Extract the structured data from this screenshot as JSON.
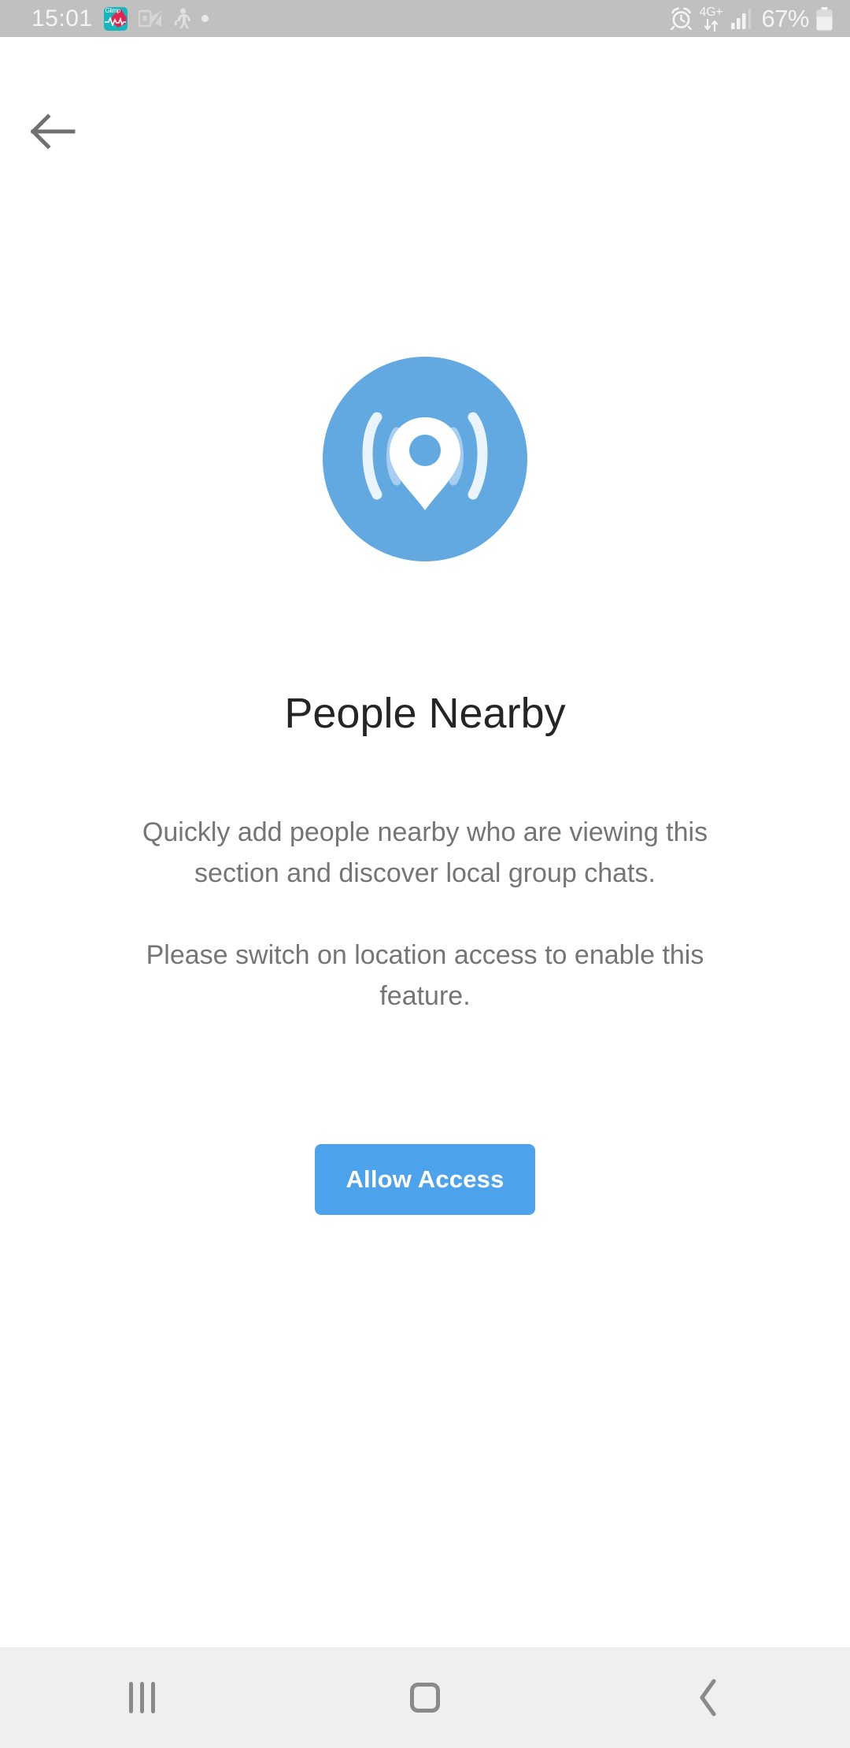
{
  "status_bar": {
    "clock": "15:01",
    "left_icons": [
      {
        "name": "glimp-app-icon",
        "label": "Glimp"
      },
      {
        "name": "outlook-notification-icon",
        "label": ""
      },
      {
        "name": "walking-person-icon",
        "label": ""
      },
      {
        "name": "notification-dot-icon",
        "label": ""
      }
    ],
    "network_type": "4G+",
    "battery_percent": "67%",
    "right_icons": [
      "alarm-icon",
      "data-transfer-arrows-icon",
      "signal-bars-icon",
      "battery-icon"
    ],
    "background_color": "#c0c0c0",
    "foreground_color": "#f4f4f4"
  },
  "app_bar": {
    "back_label": "Back"
  },
  "main": {
    "hero_icon_name": "people-nearby-location-broadcast-icon",
    "hero_icon_bg": "#62a9e2",
    "title": "People Nearby",
    "paragraphs": [
      "Quickly add people nearby who are viewing this section and discover local group chats.",
      "Please switch on location access to enable this feature."
    ],
    "primary_button": {
      "label": "Allow Access",
      "color": "#4da3eb",
      "text_color": "#ffffff"
    }
  },
  "nav_bar": {
    "background_color": "#efefef",
    "buttons": [
      {
        "name": "recents",
        "label": "Recents"
      },
      {
        "name": "home",
        "label": "Home"
      },
      {
        "name": "back",
        "label": "Back"
      }
    ]
  }
}
